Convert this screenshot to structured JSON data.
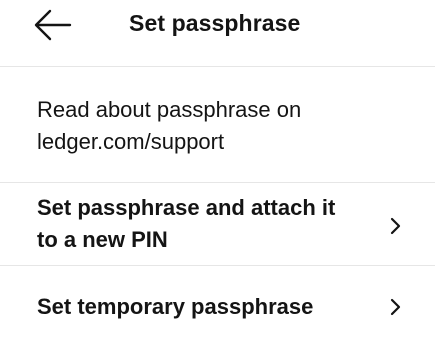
{
  "header": {
    "title": "Set passphrase",
    "back_icon": "arrow-left-icon"
  },
  "info": {
    "text": "Read about passphrase on ledger.com/support"
  },
  "menu": {
    "items": [
      {
        "label": "Set passphrase and attach it to a new PIN",
        "icon": "chevron-right-icon"
      },
      {
        "label": "Set temporary passphrase",
        "icon": "chevron-right-icon"
      }
    ]
  },
  "colors": {
    "text": "#141414",
    "background": "#ffffff",
    "divider": "#e6e6e6"
  }
}
